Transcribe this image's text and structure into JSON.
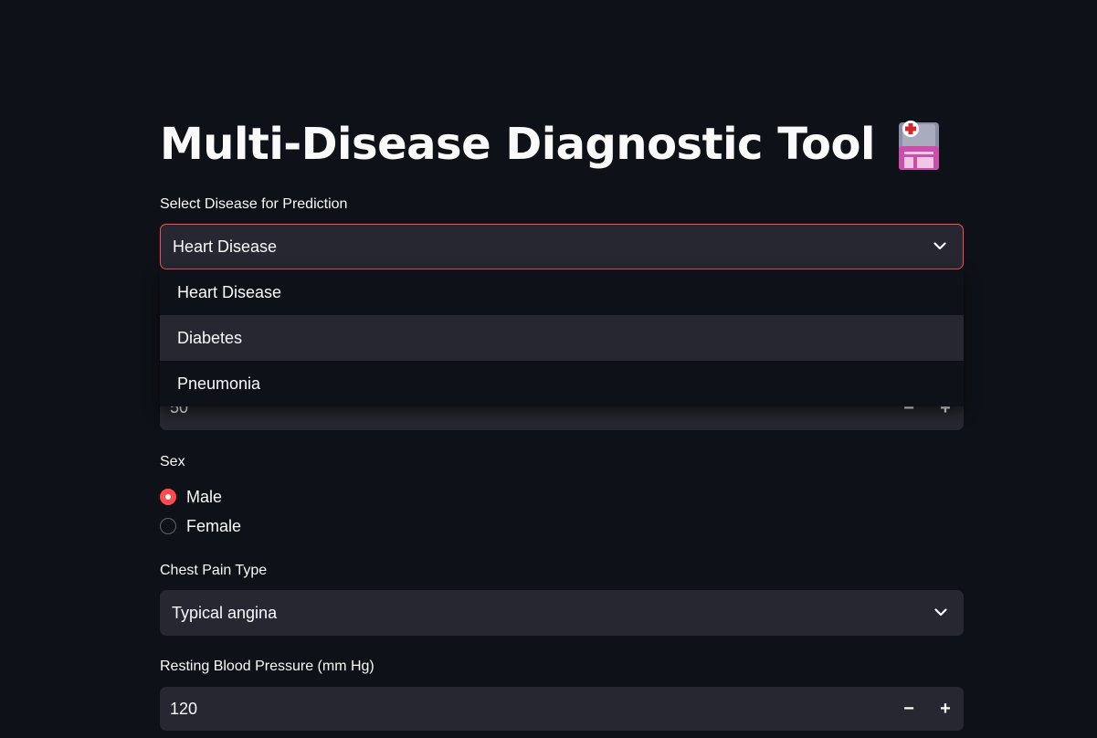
{
  "page": {
    "title": "Multi-Disease Diagnostic Tool"
  },
  "icons": {
    "title_icon": "hospital-clipboard-icon",
    "dropdown_caret": "chevron-down-icon",
    "decrement": "minus-icon",
    "increment": "plus-icon"
  },
  "colors": {
    "background": "#0e1117",
    "widget_bg": "#262730",
    "accent": "#ff4b4b",
    "text": "#fafafa"
  },
  "disease_select": {
    "label": "Select Disease for Prediction",
    "value": "Heart Disease",
    "options": [
      "Heart Disease",
      "Diabetes",
      "Pneumonia"
    ],
    "highlighted_option": "Diabetes"
  },
  "age_input": {
    "value": "50",
    "decrement_label": "−",
    "increment_label": "+"
  },
  "sex": {
    "label": "Sex",
    "options": [
      "Male",
      "Female"
    ],
    "selected": "Male"
  },
  "chest_pain": {
    "label": "Chest Pain Type",
    "value": "Typical angina"
  },
  "resting_bp": {
    "label": "Resting Blood Pressure (mm Hg)",
    "value": "120",
    "decrement_label": "−",
    "increment_label": "+"
  }
}
